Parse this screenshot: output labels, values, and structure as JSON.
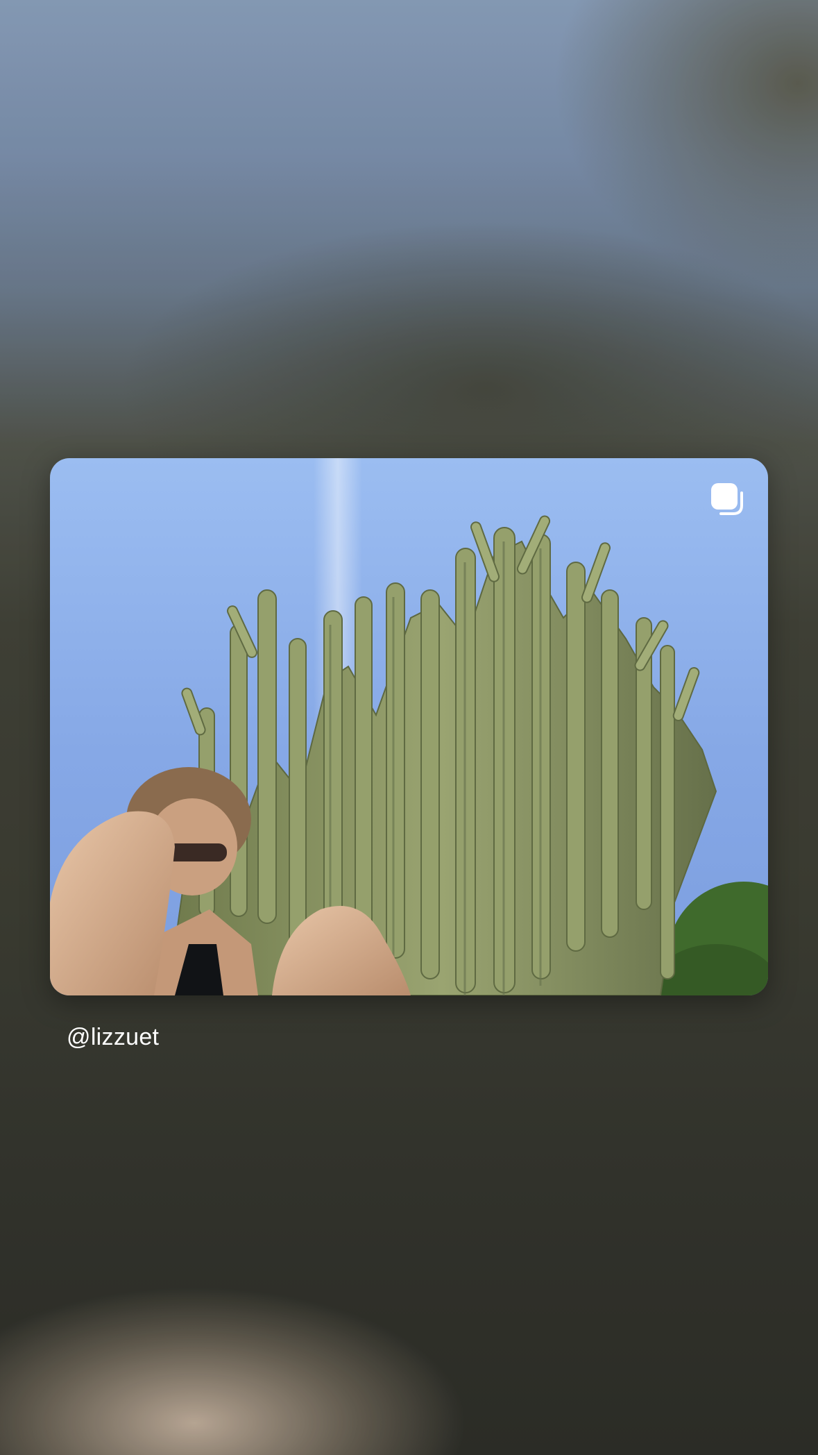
{
  "post": {
    "username": "@lizzuet",
    "media_type": "photo",
    "repost_icon": "repost-icon"
  },
  "colors": {
    "backdrop_top": "#8fa5c2",
    "backdrop_bottom": "#2f302a",
    "sky": "#8fb0ea",
    "cactus": "#8f9a68",
    "text": "#ffffff"
  }
}
